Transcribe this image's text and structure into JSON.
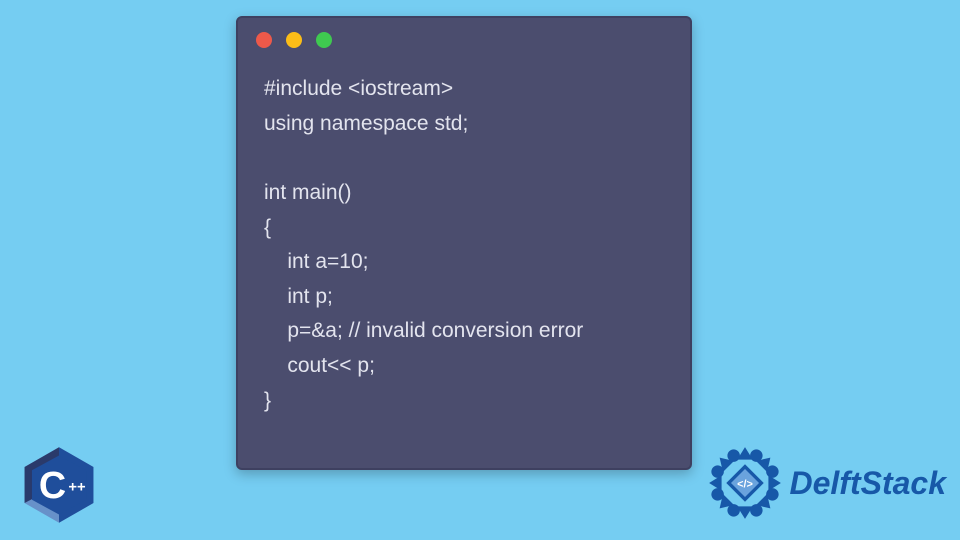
{
  "window": {
    "dots": {
      "red": "#ed594a",
      "yellow": "#fbbd18",
      "green": "#3fc950"
    }
  },
  "code": {
    "lines": [
      "#include <iostream>",
      "using namespace std;",
      "",
      "int main()",
      "{",
      "    int a=10;",
      "    int p;",
      "    p=&a; // invalid conversion error",
      "    cout<< p;",
      "}"
    ]
  },
  "cpp_logo": {
    "letter": "C",
    "plusplus": "++"
  },
  "brand": {
    "name": "DelftStack",
    "glyph": "</>"
  }
}
